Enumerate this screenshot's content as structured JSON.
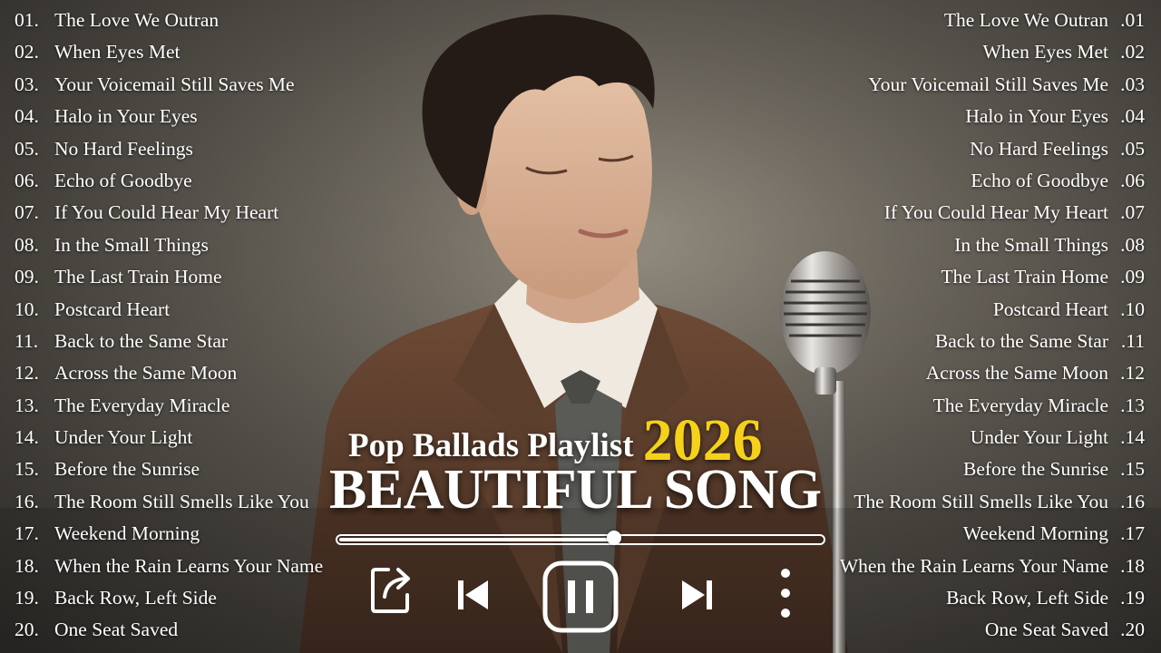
{
  "left_tracks": [
    {
      "num": "01.",
      "title": "The Love We Outran"
    },
    {
      "num": "02.",
      "title": "When Eyes Met"
    },
    {
      "num": "03.",
      "title": "Your Voicemail Still Saves Me"
    },
    {
      "num": "04.",
      "title": "Halo in Your Eyes"
    },
    {
      "num": "05.",
      "title": "No Hard Feelings"
    },
    {
      "num": "06.",
      "title": "Echo of Goodbye"
    },
    {
      "num": "07.",
      "title": "If You Could Hear My Heart"
    },
    {
      "num": "08.",
      "title": "In the Small Things"
    },
    {
      "num": "09.",
      "title": "The Last Train Home"
    },
    {
      "num": "10.",
      "title": "Postcard Heart"
    },
    {
      "num": "11.",
      "title": "Back to the Same Star"
    },
    {
      "num": "12.",
      "title": "Across the Same Moon"
    },
    {
      "num": "13.",
      "title": "The Everyday Miracle"
    },
    {
      "num": "14.",
      "title": "Under Your Light"
    },
    {
      "num": "15.",
      "title": "Before the Sunrise"
    },
    {
      "num": "16.",
      "title": "The Room Still Smells Like You"
    },
    {
      "num": "17.",
      "title": "Weekend Morning"
    },
    {
      "num": "18.",
      "title": "When the Rain Learns Your Name"
    },
    {
      "num": "19.",
      "title": "Back Row, Left Side"
    },
    {
      "num": "20.",
      "title": "One Seat Saved"
    }
  ],
  "right_tracks": [
    {
      "num": ".01",
      "title": "The Love We Outran"
    },
    {
      "num": ".02",
      "title": "When Eyes Met"
    },
    {
      "num": ".03",
      "title": "Your Voicemail Still Saves Me"
    },
    {
      "num": ".04",
      "title": "Halo in Your Eyes"
    },
    {
      "num": ".05",
      "title": "No Hard Feelings"
    },
    {
      "num": ".06",
      "title": "Echo of Goodbye"
    },
    {
      "num": ".07",
      "title": "If You Could Hear My Heart"
    },
    {
      "num": ".08",
      "title": "In the Small Things"
    },
    {
      "num": ".09",
      "title": "The Last Train Home"
    },
    {
      "num": ".10",
      "title": "Postcard Heart"
    },
    {
      "num": ".11",
      "title": "Back to the Same Star"
    },
    {
      "num": ".12",
      "title": "Across the Same Moon"
    },
    {
      "num": ".13",
      "title": "The Everyday Miracle"
    },
    {
      "num": ".14",
      "title": "Under Your Light"
    },
    {
      "num": ".15",
      "title": "Before the Sunrise"
    },
    {
      "num": ".16",
      "title": "The Room Still Smells Like You"
    },
    {
      "num": ".17",
      "title": "Weekend Morning"
    },
    {
      "num": ".18",
      "title": "When the Rain Learns Your Name"
    },
    {
      "num": ".19",
      "title": "Back Row, Left Side"
    },
    {
      "num": ".20",
      "title": "One Seat Saved"
    }
  ],
  "title": {
    "line1": "Pop Ballads Playlist",
    "year": "2026",
    "line2": "BEAUTIFUL SONG"
  },
  "player": {
    "progress_fraction": 0.57,
    "controls": [
      "share-icon",
      "previous-icon",
      "pause-icon",
      "next-icon",
      "more-vertical-icon"
    ]
  },
  "colors": {
    "text": "#ffffff",
    "accent_year": "#f5d21a",
    "background": "#5f5a52"
  }
}
